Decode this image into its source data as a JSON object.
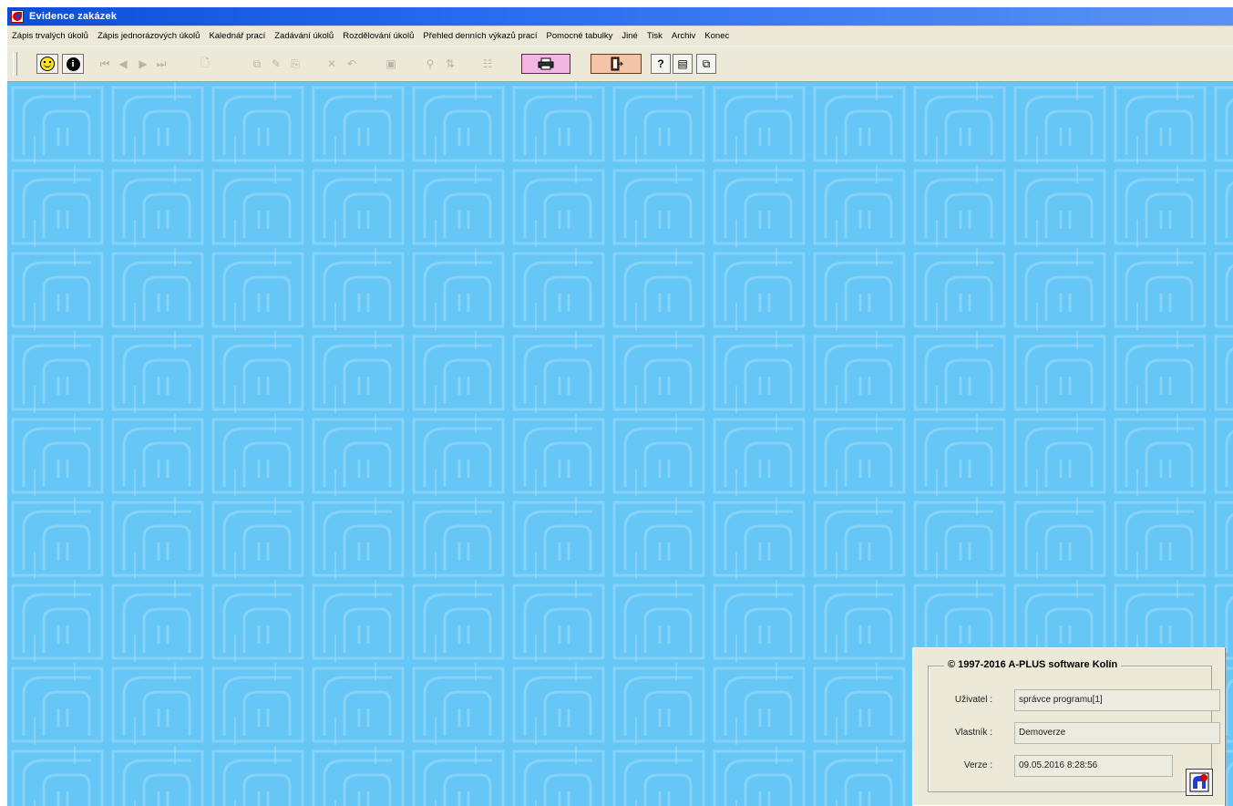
{
  "window": {
    "title": "Evidence zakázek"
  },
  "menu": {
    "items": [
      "Zápis trvalých úkolů",
      "Zápis jednorázových úkolů",
      "Kalednář prací",
      "Zadávání úkolů",
      "Rozdělování úkolů",
      "Přehled denních výkazů prací",
      "Pomocné tabulky",
      "Jiné",
      "Tisk",
      "Archiv",
      "Konec"
    ]
  },
  "toolbar": {
    "icons": [
      "smiley-icon",
      "info-icon",
      "first-record-icon",
      "prev-record-icon",
      "next-record-icon",
      "last-record-icon",
      "new-record-icon",
      "copy-icon",
      "edit-icon",
      "paste-icon",
      "delete-icon",
      "undo-icon",
      "save-icon",
      "find-icon",
      "sort-icon",
      "filter-icon",
      "print-icon",
      "exit-icon",
      "key-icon",
      "notes-icon",
      "windows-icon"
    ]
  },
  "about": {
    "heading": "© 1997-2016  A-PLUS software Kolín",
    "user_label": "Uživatel :",
    "user_value": "správce programu[1]",
    "owner_label": "Vlastník :",
    "owner_value": "Demoverze",
    "version_label": "Verze :",
    "version_value": "09.05.2016  8:28:56"
  },
  "colors": {
    "workspace_bg": "#66c6f6",
    "title_bar": "#0a4fd6",
    "pattern_line": "#8ed6fa"
  }
}
